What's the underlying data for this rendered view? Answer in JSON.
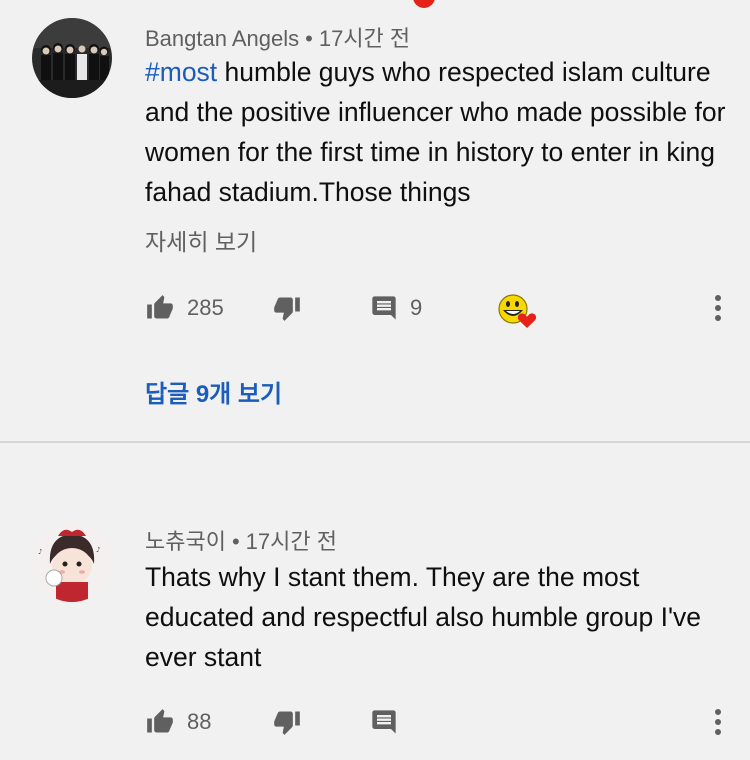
{
  "comments": [
    {
      "author": "Bangtan Angels",
      "time": "17시간 전",
      "separator": "•",
      "hashtag": "#most",
      "text": " humble guys who respected islam culture and the positive influencer who made possible for women for the first time in history to enter in king fahad stadium.Those things",
      "read_more": "자세히 보기",
      "likes": "285",
      "replies_count": "9",
      "view_replies": "답글 9개 보기"
    },
    {
      "author": "노츄국이",
      "time": "17시간 전",
      "separator": "•",
      "text": "Thats why I stant them. They are the most educated and respectful also humble group I've ever stant",
      "likes": "88"
    }
  ],
  "icons": {
    "like": "thumbs-up-icon",
    "dislike": "thumbs-down-icon",
    "reply": "comment-icon",
    "more": "more-vertical-icon",
    "creator_heart": "smiley-heart-icon"
  },
  "colors": {
    "link": "#1a5dba",
    "secondary_text": "#606060",
    "background": "#f1f1f1",
    "heart": "#e62117"
  }
}
